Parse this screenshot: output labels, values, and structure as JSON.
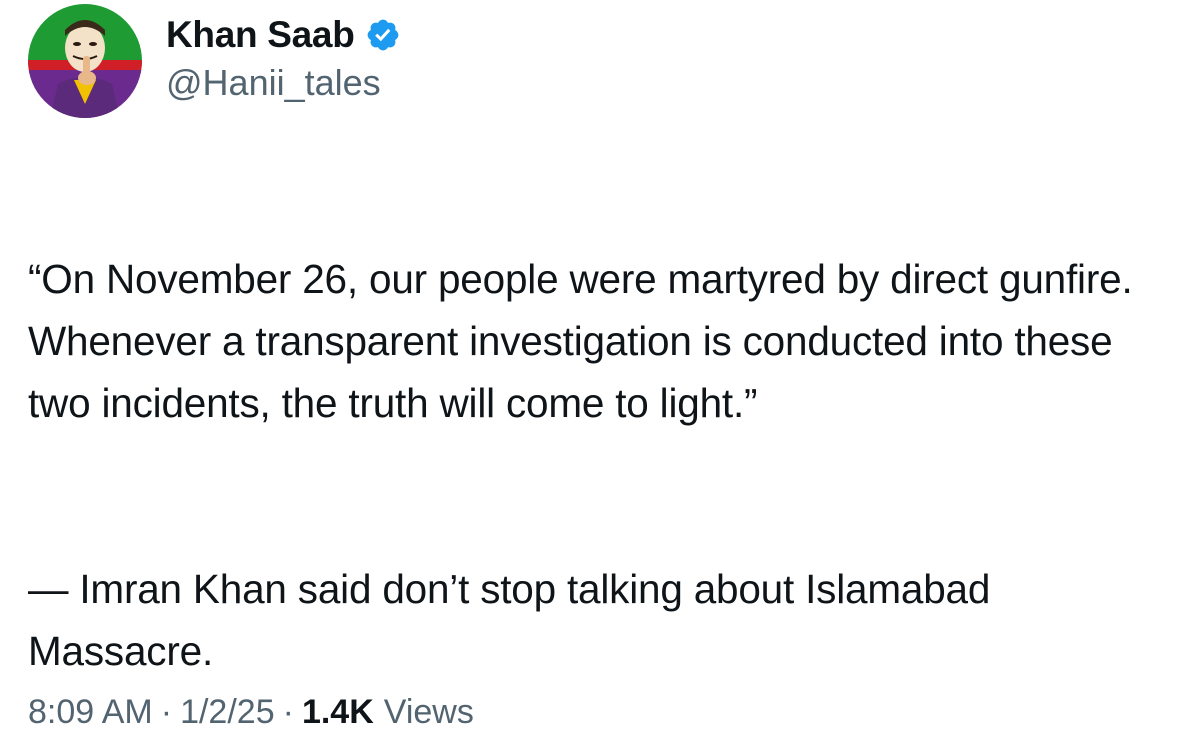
{
  "author": {
    "display_name": "Khan Saab",
    "handle": "@Hanii_tales",
    "verified": true,
    "verified_icon": "verified-badge-icon",
    "avatar": "masked-man-avatar"
  },
  "tweet": {
    "paragraph_1": "“On November 26, our people were martyred by direct gunfire. Whenever a transparent investigation is conducted into these two incidents, the truth will come to light.”",
    "paragraph_2": "— Imran Khan said don’t stop talking about Islamabad Massacre."
  },
  "meta": {
    "time": "8:09 AM",
    "separator": "·",
    "date": "1/2/25",
    "views_count": "1.4K",
    "views_label": "Views"
  },
  "colors": {
    "text": "#0f1419",
    "secondary": "#536471",
    "verified_blue": "#1d9bf0",
    "avatar_green": "#1e9b33",
    "avatar_red": "#d01f26",
    "avatar_purple": "#6a2a8e"
  }
}
